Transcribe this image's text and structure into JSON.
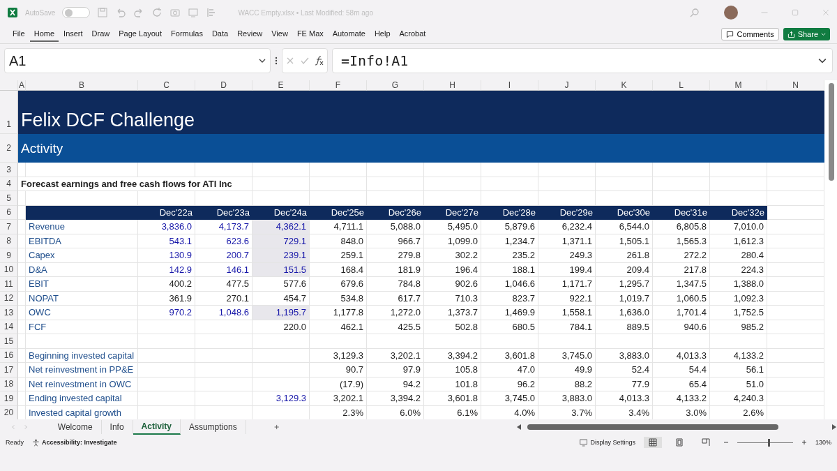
{
  "title_bar": {
    "autosave_label": "AutoSave",
    "autosave_on": false,
    "file_title": "WACC Empty.xlsx • Last Modified: 58m ago"
  },
  "ribbon": {
    "tabs": [
      {
        "label": "File",
        "selected": false
      },
      {
        "label": "Home",
        "selected": true
      },
      {
        "label": "Insert",
        "selected": false
      },
      {
        "label": "Draw",
        "selected": false
      },
      {
        "label": "Page Layout",
        "selected": false
      },
      {
        "label": "Formulas",
        "selected": false
      },
      {
        "label": "Data",
        "selected": false
      },
      {
        "label": "Review",
        "selected": false
      },
      {
        "label": "View",
        "selected": false
      },
      {
        "label": "FE Max",
        "selected": false
      },
      {
        "label": "Automate",
        "selected": false
      },
      {
        "label": "Help",
        "selected": false
      },
      {
        "label": "Acrobat",
        "selected": false
      }
    ],
    "comments": "Comments",
    "share": "Share"
  },
  "formula_bar": {
    "name_box": "A1",
    "formula": "=Info!A1"
  },
  "sheet": {
    "columns": [
      "A",
      "B",
      "C",
      "D",
      "E",
      "F",
      "G",
      "H",
      "I",
      "J",
      "K",
      "L",
      "M",
      "N"
    ],
    "rows": [
      {
        "num": "1",
        "kind": "title",
        "text": "Felix DCF Challenge"
      },
      {
        "num": "2",
        "kind": "subtitle",
        "text": "Activity"
      },
      {
        "num": "3",
        "kind": "blank"
      },
      {
        "num": "4",
        "kind": "heading",
        "text": "Forecast earnings and free cash flows for ATI Inc"
      },
      {
        "num": "5",
        "kind": "blank"
      },
      {
        "num": "6",
        "kind": "header",
        "cells": [
          "Dec'22a",
          "Dec'23a",
          "Dec'24a",
          "Dec'25e",
          "Dec'26e",
          "Dec'27e",
          "Dec'28e",
          "Dec'29e",
          "Dec'30e",
          "Dec'31e",
          "Dec'32e"
        ]
      },
      {
        "num": "7",
        "kind": "data",
        "label": "Revenue",
        "input": true,
        "shaded": true,
        "cells": [
          "3,836.0",
          "4,173.7",
          "4,362.1",
          "4,711.1",
          "5,088.0",
          "5,495.0",
          "5,879.6",
          "6,232.4",
          "6,544.0",
          "6,805.8",
          "7,010.0"
        ]
      },
      {
        "num": "8",
        "kind": "data",
        "label": "EBITDA",
        "input": true,
        "shaded": true,
        "cells": [
          "543.1",
          "623.6",
          "729.1",
          "848.0",
          "966.7",
          "1,099.0",
          "1,234.7",
          "1,371.1",
          "1,505.1",
          "1,565.3",
          "1,612.3"
        ]
      },
      {
        "num": "9",
        "kind": "data",
        "label": "Capex",
        "input": true,
        "shaded": true,
        "cells": [
          "130.9",
          "200.7",
          "239.1",
          "259.1",
          "279.8",
          "302.2",
          "235.2",
          "249.3",
          "261.8",
          "272.2",
          "280.4"
        ]
      },
      {
        "num": "10",
        "kind": "data",
        "label": "D&A",
        "input": true,
        "shaded": true,
        "cells": [
          "142.9",
          "146.1",
          "151.5",
          "168.4",
          "181.9",
          "196.4",
          "188.1",
          "199.4",
          "209.4",
          "217.8",
          "224.3"
        ]
      },
      {
        "num": "11",
        "kind": "data",
        "label": "EBIT",
        "input": false,
        "shaded": false,
        "cells": [
          "400.2",
          "477.5",
          "577.6",
          "679.6",
          "784.8",
          "902.6",
          "1,046.6",
          "1,171.7",
          "1,295.7",
          "1,347.5",
          "1,388.0"
        ]
      },
      {
        "num": "12",
        "kind": "data",
        "label": "NOPAT",
        "input": false,
        "shaded": false,
        "cells": [
          "361.9",
          "270.1",
          "454.7",
          "534.8",
          "617.7",
          "710.3",
          "823.7",
          "922.1",
          "1,019.7",
          "1,060.5",
          "1,092.3"
        ]
      },
      {
        "num": "13",
        "kind": "data",
        "label": "OWC",
        "input": true,
        "shaded": true,
        "cells": [
          "970.2",
          "1,048.6",
          "1,195.7",
          "1,177.8",
          "1,272.0",
          "1,373.7",
          "1,469.9",
          "1,558.1",
          "1,636.0",
          "1,701.4",
          "1,752.5"
        ]
      },
      {
        "num": "14",
        "kind": "data",
        "label": "FCF",
        "input": false,
        "shaded": false,
        "cells": [
          null,
          null,
          "220.0",
          "462.1",
          "425.5",
          "502.8",
          "680.5",
          "784.1",
          "889.5",
          "940.6",
          "985.2"
        ]
      },
      {
        "num": "15",
        "kind": "blank"
      },
      {
        "num": "16",
        "kind": "data",
        "label": "Beginning invested capital",
        "input": false,
        "shaded": false,
        "cells": [
          null,
          null,
          null,
          "3,129.3",
          "3,202.1",
          "3,394.2",
          "3,601.8",
          "3,745.0",
          "3,883.0",
          "4,013.3",
          "4,133.2"
        ]
      },
      {
        "num": "17",
        "kind": "data",
        "label": "Net reinvestment in PP&E",
        "input": false,
        "shaded": false,
        "cells": [
          null,
          null,
          null,
          "90.7",
          "97.9",
          "105.8",
          "47.0",
          "49.9",
          "52.4",
          "54.4",
          "56.1"
        ]
      },
      {
        "num": "18",
        "kind": "data",
        "label": "Net reinvestment in OWC",
        "input": false,
        "shaded": false,
        "cells": [
          null,
          null,
          null,
          "(17.9)",
          "94.2",
          "101.8",
          "96.2",
          "88.2",
          "77.9",
          "65.4",
          "51.0"
        ]
      },
      {
        "num": "19",
        "kind": "data",
        "label": "Ending invested capital",
        "input": true,
        "shaded": false,
        "cells": [
          null,
          null,
          "3,129.3",
          "3,202.1",
          "3,394.2",
          "3,601.8",
          "3,745.0",
          "3,883.0",
          "4,013.3",
          "4,133.2",
          "4,240.3"
        ]
      },
      {
        "num": "20",
        "kind": "data",
        "label": "Invested capital growth",
        "input": false,
        "shaded": false,
        "cells": [
          null,
          null,
          null,
          "2.3%",
          "6.0%",
          "6.1%",
          "4.0%",
          "3.7%",
          "3.4%",
          "3.0%",
          "2.6%"
        ]
      }
    ]
  },
  "sheet_tabs": [
    {
      "label": "Welcome",
      "selected": false
    },
    {
      "label": "Info",
      "selected": false
    },
    {
      "label": "Activity",
      "selected": true
    },
    {
      "label": "Assumptions",
      "selected": false
    }
  ],
  "status_bar": {
    "ready": "Ready",
    "accessibility": "Accessibility: Investigate",
    "display_settings": "Display Settings",
    "level": 0.55,
    "zoom": "130%"
  }
}
